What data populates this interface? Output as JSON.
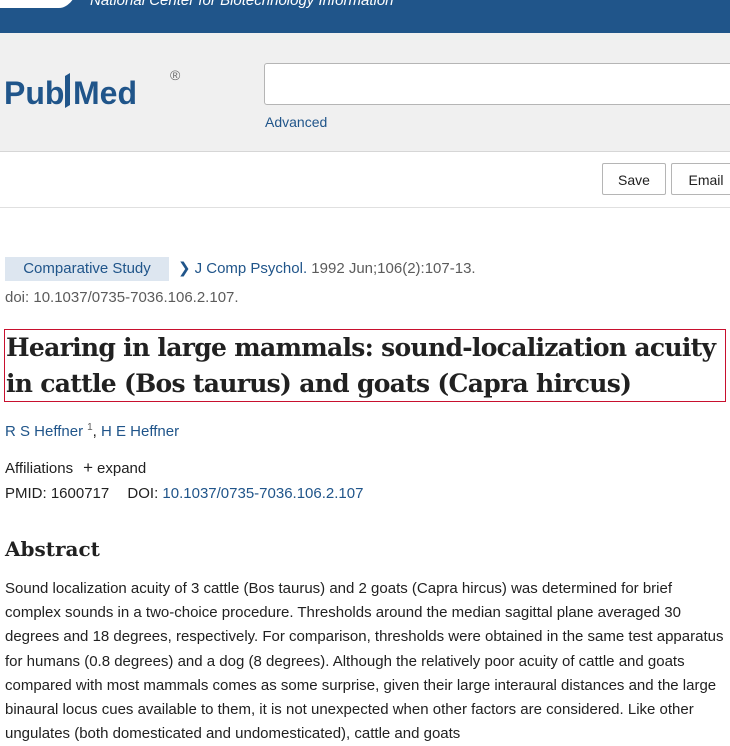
{
  "header": {
    "org_name": "National Center for Biotechnology Information"
  },
  "search": {
    "logo_text": "PubMed",
    "registered_mark": "®",
    "query_value": "",
    "advanced_label": "Advanced"
  },
  "actions": {
    "save_label": "Save",
    "email_label": "Email"
  },
  "article": {
    "publication_type": "Comparative Study",
    "journal": "J Comp Psychol.",
    "citation": "1992 Jun;106(2):107-13.",
    "doi_line": "doi: 10.1037/0735-7036.106.2.107.",
    "title": "Hearing in large mammals: sound-localization acuity in cattle (Bos taurus) and goats (Capra hircus)",
    "authors": [
      {
        "name": "R S Heffner",
        "sup": "1"
      },
      {
        "name": "H E Heffner"
      }
    ],
    "author_separator": ",",
    "affiliations_label": "Affiliations",
    "expand_label": "expand",
    "pmid_label": "PMID: 1600717",
    "doi_label": "DOI:",
    "doi_value": "10.1037/0735-7036.106.2.107",
    "abstract_heading": "Abstract",
    "abstract_text": "Sound localization acuity of 3 cattle (Bos taurus) and 2 goats (Capra hircus) was determined for brief complex sounds in a two-choice procedure. Thresholds around the median sagittal plane averaged 30 degrees and 18 degrees, respectively. For comparison, thresholds were obtained in the same test apparatus for humans (0.8 degrees) and a dog (8 degrees). Although the relatively poor acuity of cattle and goats compared with most mammals comes as some surprise, given their large interaural distances and the large binaural locus cues available to them, it is not unexpected when other factors are considered. Like other ungulates (both domesticated and undomesticated), cattle and goats"
  },
  "colors": {
    "ncbi_blue": "#20558a",
    "link_blue": "#20558a",
    "title_border": "#c8102e",
    "pubmed_accent": "#20558a"
  }
}
